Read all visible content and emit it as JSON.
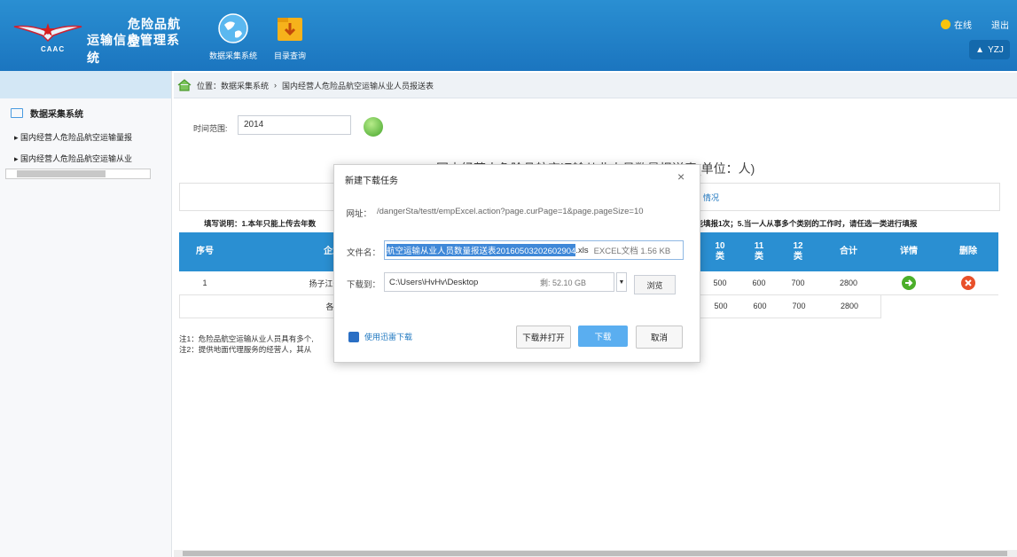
{
  "header": {
    "logo_line1": "危险品航空",
    "logo_line2": "运输信息管理系统",
    "logo_caac": "CAAC",
    "nav": [
      {
        "label": "数据采集系统",
        "icon": "globe-icon"
      },
      {
        "label": "目录查询",
        "icon": "folder-download-icon"
      }
    ],
    "online": "在线",
    "logout": "退出",
    "user": "YZJ"
  },
  "sidebar": {
    "title": "数据采集系统",
    "items": [
      "国内经营人危险品航空运输量报",
      "国内经营人危险品航空运输从业"
    ]
  },
  "breadcrumb": {
    "label": "位置：",
    "path1": "数据采集系统",
    "sep": "›",
    "path2": "国内经营人危险品航空运输从业人员报送表"
  },
  "filter": {
    "label": "时间范围:",
    "value": "2014"
  },
  "table": {
    "title": "国内经营人危险品航空运输从业人员数量报送表(单位：人)",
    "top_right": "情况",
    "note_left": "填写说明：1.本年只能上传去年数",
    "note_right": "只能填报1次；5.当一人从事多个类别的工作时，请任选一类进行填报",
    "headers": {
      "seq": "序号",
      "company": "企业名",
      "c10": "10\n类",
      "c11": "11\n类",
      "c12": "12\n类",
      "total": "合计",
      "detail": "详情",
      "delete": "删除"
    },
    "row1": {
      "seq": "1",
      "company": "扬子江快运航空",
      "c10": "500",
      "c11": "600",
      "c12": "700",
      "total": "2800"
    },
    "row2": {
      "label": "各类别",
      "c10": "500",
      "c11": "600",
      "c12": "700",
      "total": "2800"
    }
  },
  "notes": [
    "注1：危险品航空运输从业人员具有多个,",
    "注2：提供地面代理服务的经营人，其从"
  ],
  "dialog": {
    "title": "新建下载任务",
    "close": "×",
    "url_label": "网址：",
    "url": "/dangerSta/testt/empExcel.action?page.curPage=1&page.pageSize=10",
    "file_label": "文件名：",
    "file_selected": "航空运输从业人员数量报送表20160503202602904",
    "file_ext": ".xls",
    "file_info": "EXCEL文档 1.56 KB",
    "path_label": "下载到：",
    "path": "C:\\Users\\HvHv\\Desktop",
    "free": "剩: 52.10 GB",
    "browse": "浏览",
    "thunder": "使用迅雷下载",
    "btn_download_open": "下载并打开",
    "btn_download": "下载",
    "btn_cancel": "取消"
  },
  "colors": {
    "header": "#1b75bf",
    "accent": "#2a8fd2",
    "detail": "#4caf2a",
    "delete": "#e8502a"
  }
}
